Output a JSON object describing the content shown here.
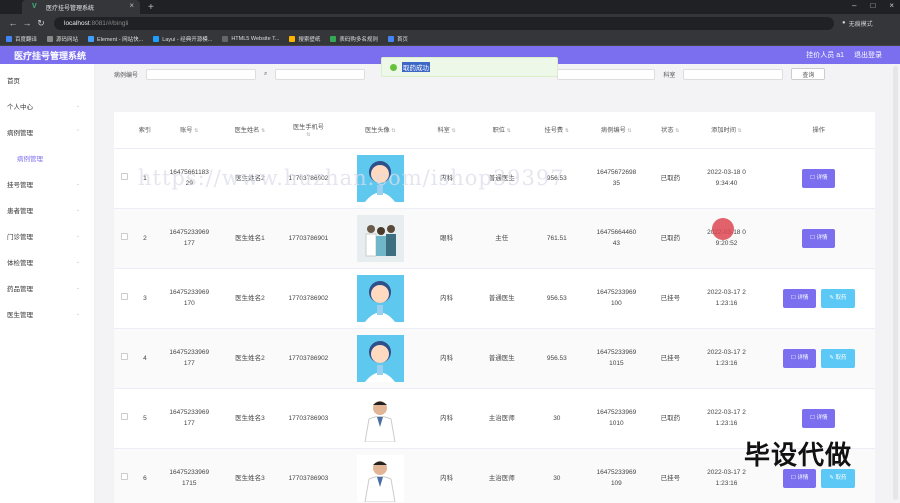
{
  "browser": {
    "tab_title": "医疗挂号管理系统",
    "url_host": "localhost",
    "url_rest": ":8081/#/bingli",
    "incognito": "无痕模式",
    "bookmarks": [
      "百度翻译",
      "源码网站",
      "Element - 网站快...",
      "Layui - 经典开源模...",
      "HTML5 Website T...",
      "搜索壁纸",
      "表码购多名规则",
      "首页"
    ]
  },
  "header": {
    "title": "医疗挂号管理系统",
    "user": "挂价人员 a1",
    "logout": "退出登录"
  },
  "sidebar": {
    "items": [
      {
        "label": "首页",
        "chev": false
      },
      {
        "label": "个人中心",
        "chev": true
      },
      {
        "label": "病例管理",
        "chev": true
      },
      {
        "label": "病例管理",
        "sub": true
      },
      {
        "label": "挂号管理",
        "chev": true
      },
      {
        "label": "患者管理",
        "chev": true
      },
      {
        "label": "门诊管理",
        "chev": true
      },
      {
        "label": "体检管理",
        "chev": true
      },
      {
        "label": "药品管理",
        "chev": true
      },
      {
        "label": "医生管理",
        "chev": true
      }
    ]
  },
  "filter": {
    "label1": "病例编号",
    "label2": "科室",
    "search_btn": "查询"
  },
  "toast": "取药成功",
  "table": {
    "headers": [
      "索引",
      "账号",
      "医生姓名",
      "医生手机号",
      "医生头像",
      "科室",
      "职位",
      "挂号费",
      "病例编号",
      "状态",
      "添加时间",
      "操作"
    ],
    "rows": [
      {
        "idx": "1",
        "account": "1647566118329",
        "name": "医生姓名2",
        "phone": "17703786902",
        "dept": "内科",
        "title": "普通医生",
        "fee": "956.53",
        "case": "1647567269835",
        "status": "已取药",
        "time": "2022-03-18 09:34:40",
        "ops": [
          "详情"
        ],
        "avatar": "cartoon"
      },
      {
        "idx": "2",
        "account": "16475233969177",
        "name": "医生姓名1",
        "phone": "17703786901",
        "dept": "眼科",
        "title": "主任",
        "fee": "761.51",
        "case": "1647566446043",
        "status": "已取药",
        "time": "2022-03-18 09:20:52",
        "ops": [
          "详情"
        ],
        "avatar": "team"
      },
      {
        "idx": "3",
        "account": "16475233969170",
        "name": "医生姓名2",
        "phone": "17703786902",
        "dept": "内科",
        "title": "普通医生",
        "fee": "956.53",
        "case": "16475233969100",
        "status": "已挂号",
        "time": "2022-03-17 21:23:16",
        "ops": [
          "详情",
          "取药"
        ],
        "avatar": "cartoon"
      },
      {
        "idx": "4",
        "account": "16475233969177",
        "name": "医生姓名2",
        "phone": "17703786902",
        "dept": "内科",
        "title": "普通医生",
        "fee": "956.53",
        "case": "164752339691015",
        "status": "已挂号",
        "time": "2022-03-17 21:23:16",
        "ops": [
          "详情",
          "取药"
        ],
        "avatar": "cartoon"
      },
      {
        "idx": "5",
        "account": "16475233969177",
        "name": "医生姓名3",
        "phone": "17703786903",
        "dept": "内科",
        "title": "主治医师",
        "fee": "30",
        "case": "164752339691010",
        "status": "已取药",
        "time": "2022-03-17 21:23:16",
        "ops": [
          "详情"
        ],
        "avatar": "doctor"
      },
      {
        "idx": "6",
        "account": "164752339691715",
        "name": "医生姓名3",
        "phone": "17703786903",
        "dept": "内科",
        "title": "主治医师",
        "fee": "30",
        "case": "16475233969109",
        "status": "已挂号",
        "time": "2022-03-17 21:23:16",
        "ops": [
          "详情",
          "取药"
        ],
        "avatar": "doctor"
      }
    ]
  },
  "watermark": "https://www.huzhan.com/ishop39397",
  "stamp": "毕设代做"
}
